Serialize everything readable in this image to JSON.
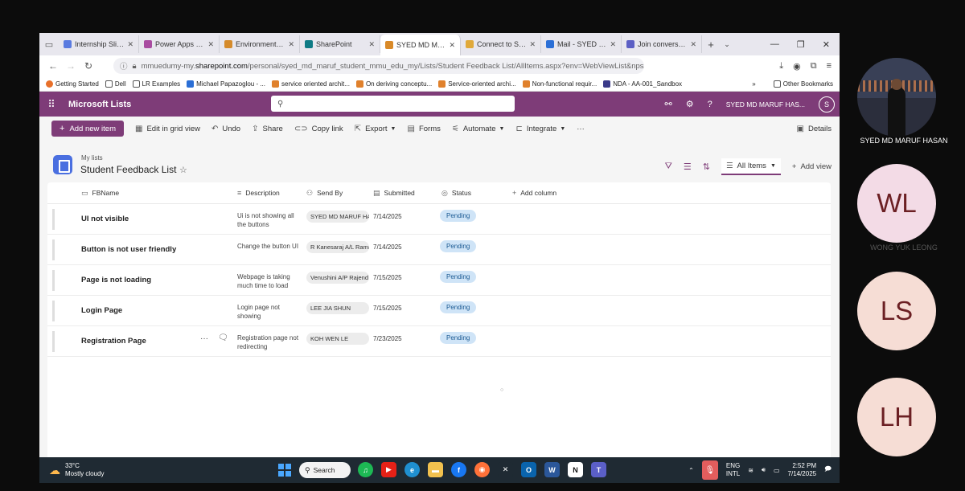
{
  "browser": {
    "tabs": [
      {
        "label": "Internship Slide - ",
        "color": "#5a7be0"
      },
      {
        "label": "Power Apps | Hom",
        "color": "#a94ca1"
      },
      {
        "label": "Environments | Po",
        "color": "#d58b2b"
      },
      {
        "label": "SharePoint",
        "color": "#0f7b85"
      },
      {
        "label": "SYED MD MARUF",
        "color": "#d98a28",
        "active": true
      },
      {
        "label": "Connect to ShareP",
        "color": "#e0a93a"
      },
      {
        "label": "Mail - SYED MD M",
        "color": "#2b6fd6"
      },
      {
        "label": "Join conversation",
        "color": "#5c5fc4"
      }
    ],
    "url_prefix": "mmuedumy-my.",
    "url_host": "sharepoint.com",
    "url_path": "/personal/syed_md_maruf_student_mmu_edu_my/Lists/Student Feedback List/AllItems.aspx?env=WebViewList&npsAction=",
    "bookmarks": [
      {
        "label": "Getting Started",
        "color": "#e8702a"
      },
      {
        "label": "Dell",
        "color": "#ffffff"
      },
      {
        "label": "LR Examples",
        "color": "#ffffff"
      },
      {
        "label": "Michael Papazoglou - ...",
        "color": "#2b6fd6"
      },
      {
        "label": "service oriented archit...",
        "color": "#e0812c"
      },
      {
        "label": "On deriving conceptu...",
        "color": "#e0812c"
      },
      {
        "label": "Service-oriented archi...",
        "color": "#e0812c"
      },
      {
        "label": "Non-functional requir...",
        "color": "#e0812c"
      },
      {
        "label": "NDA - AA-001_Sandbox",
        "color": "#3b3b8a"
      }
    ],
    "other_bookmarks": "Other Bookmarks"
  },
  "suite": {
    "app_name": "Microsoft Lists",
    "user_name": "SYED MD MARUF HAS...",
    "avatar_letter": "S"
  },
  "commands": {
    "add_new_item": "Add new item",
    "edit_grid": "Edit in grid view",
    "undo": "Undo",
    "share": "Share",
    "copy_link": "Copy link",
    "export": "Export",
    "forms": "Forms",
    "automate": "Automate",
    "integrate": "Integrate",
    "more": "···",
    "details": "Details"
  },
  "list": {
    "breadcrumb": "My lists",
    "title": "Student Feedback List",
    "view_name": "All Items",
    "add_view": "Add view"
  },
  "columns": {
    "fbname": "FBName",
    "description": "Description",
    "send_by": "Send By",
    "submitted": "Submitted",
    "status": "Status",
    "add_column": "Add column"
  },
  "rows": [
    {
      "title": "UI not visible",
      "desc": "Ui is not showing all the buttons",
      "send_by": "SYED MD MARUF HA",
      "submitted": "7/14/2025",
      "status": "Pending"
    },
    {
      "title": "Button is not user friendly",
      "desc": "Change the button UI",
      "send_by": "R Kanesaraj A/L Rama",
      "submitted": "7/14/2025",
      "status": "Pending"
    },
    {
      "title": "Page is not loading",
      "desc": "Webpage is taking much time to load",
      "send_by": "Venushini A/P Rajend",
      "submitted": "7/15/2025",
      "status": "Pending"
    },
    {
      "title": "Login Page",
      "desc": "Login page not showing",
      "send_by": "LEE JIA SHUN",
      "submitted": "7/15/2025",
      "status": "Pending"
    },
    {
      "title": "Registration Page",
      "desc": "Registration page not redirecting",
      "send_by": "KOH WEN LE",
      "submitted": "7/23/2025",
      "status": "Pending"
    }
  ],
  "taskbar": {
    "temp": "33°C",
    "weather": "Mostly cloudy",
    "weather_badge": "1",
    "search": "Search",
    "lang_1": "ENG",
    "lang_2": "INTL",
    "time": "2:52 PM",
    "date": "7/14/2025"
  },
  "participants": [
    {
      "name": "SYED MD MARUF HASAN",
      "photo": true
    },
    {
      "name": "WONG YUK LEONG",
      "initials": "WL",
      "bg": "#f3dbe6"
    },
    {
      "name": "",
      "initials": "LS",
      "bg": "#f6ddd5"
    },
    {
      "name": "",
      "initials": "LH",
      "bg": "#f6ddd5"
    }
  ]
}
